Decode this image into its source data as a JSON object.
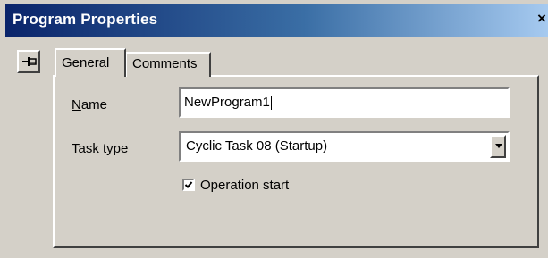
{
  "window": {
    "title": "Program Properties",
    "close_glyph": "×"
  },
  "tabs": [
    {
      "label": "General",
      "selected": true
    },
    {
      "label": "Comments",
      "selected": false
    }
  ],
  "form": {
    "name_label": "Name",
    "name_value": "NewProgram1",
    "task_type_label": "Task type",
    "task_type_value": "Cyclic Task 08 (Startup)",
    "operation_start_label": "Operation start",
    "operation_start_checked": true
  },
  "icons": {
    "pin": "pin-icon",
    "dropdown": "chevron-down-icon",
    "check": "check-icon",
    "close": "close-icon"
  },
  "colors": {
    "titlebar_start": "#0a246a",
    "titlebar_end": "#a6caf0",
    "face": "#d4d0c8"
  }
}
